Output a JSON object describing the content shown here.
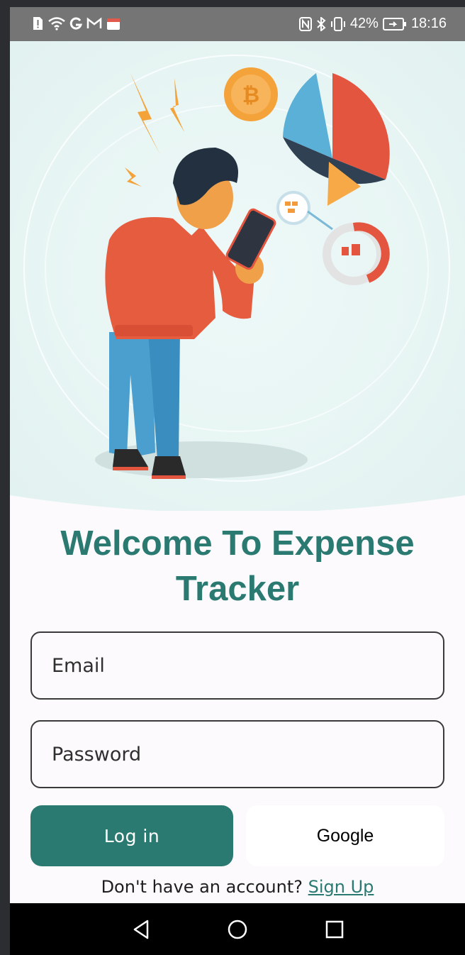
{
  "status_bar": {
    "battery": "42%",
    "time": "18:16",
    "left_icons": [
      "alert-icon",
      "wifi-icon",
      "google-icon",
      "gmail-icon",
      "calendar-icon"
    ],
    "right_icons": [
      "nfc-icon",
      "bluetooth-icon",
      "vibrate-icon",
      "battery-icon"
    ]
  },
  "hero": {
    "illustration": "man-with-phone-and-charts-illustration",
    "bg_color": "#e8f5f4"
  },
  "login": {
    "title_line1": "Welcome To Expense",
    "title_line2": "Tracker",
    "email_placeholder": "Email",
    "email_value": "",
    "password_placeholder": "Password",
    "password_value": "",
    "login_label": "Log in",
    "google_label": "Google",
    "signup_prompt": "Don't have an account?",
    "signup_link": "Sign Up"
  },
  "nav_bar": {
    "icons": [
      "back-icon",
      "home-icon",
      "recents-icon"
    ]
  },
  "colors": {
    "accent": "#2b7a72",
    "status_bar": "#757575",
    "background": "#fcfafc"
  }
}
